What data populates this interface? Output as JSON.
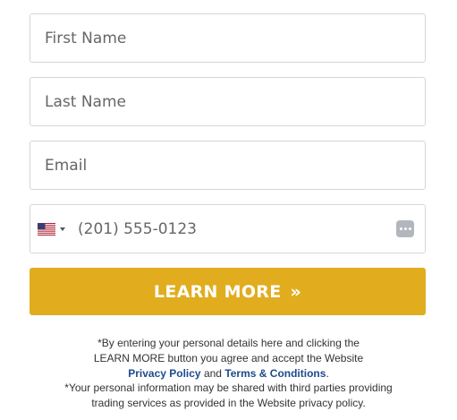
{
  "form": {
    "first_name": {
      "placeholder": "First Name",
      "value": ""
    },
    "last_name": {
      "placeholder": "Last Name",
      "value": ""
    },
    "email": {
      "placeholder": "Email",
      "value": ""
    },
    "phone": {
      "placeholder": "(201) 555-0123",
      "value": "",
      "country_icon": "us-flag-icon"
    },
    "autofill_icon": "more-dots-icon",
    "submit_label": "LEARN MORE",
    "submit_arrow": "»"
  },
  "disclaimer": {
    "line1": "*By entering your personal details here and clicking the",
    "line2": "LEARN MORE button you agree and accept the Website",
    "privacy_policy": "Privacy Policy",
    "and": " and ",
    "terms": "Terms & Conditions",
    "period": ".",
    "line4": "*Your personal information may be shared with third parties providing",
    "line5": "trading services as provided in the Website privacy policy."
  },
  "colors": {
    "button": "#e1ad1f",
    "link": "#1c4b8b",
    "border": "#d6d6d6"
  }
}
